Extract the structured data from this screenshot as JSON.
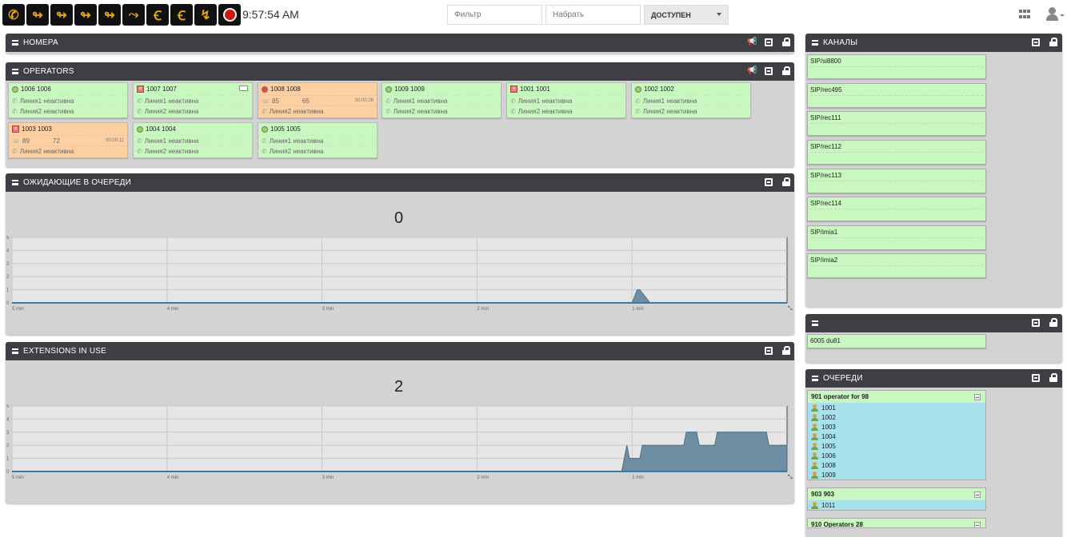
{
  "toolbar": {
    "buttons": [
      "phone-icon",
      "call-forward-icon",
      "call-forward-chat-icon",
      "call-forward-mail-icon",
      "call-forward-mobile-icon",
      "call-transfer-icon",
      "listen-icon",
      "whisper-icon",
      "hangup-icon",
      "record-stop-icon"
    ],
    "clock": "9:57:54 AM",
    "filter_placeholder": "Фильтр",
    "dial_placeholder": "Набрать",
    "status_value": "ДОСТУПЕН"
  },
  "panels": {
    "numbers": {
      "title": "НОМЕРА"
    },
    "operators": {
      "title": "OPERATORS"
    },
    "waiting": {
      "title": "ОЖИДАЮЩИЕ В ОЧЕРЕДИ",
      "count": "0"
    },
    "extensions": {
      "title": "EXTENSIONS IN USE",
      "count": "2"
    },
    "channels": {
      "title": "КАНАЛЫ"
    },
    "parked": {
      "title": ""
    },
    "queues": {
      "title": "ОЧЕРЕДИ"
    }
  },
  "operators": [
    {
      "name": "1006 1006",
      "status": "available",
      "line1": "Линия1 неактивна",
      "line2": "Линия2 неактивна"
    },
    {
      "name": "1007 1007",
      "status": "offline",
      "line1": "Линия1 неактивна",
      "line2": "Линия2 неактивна",
      "mail": true
    },
    {
      "name": "1008 1008",
      "status": "busy",
      "line1_a": "85",
      "line1_b": "65",
      "line1_time": "00:00:26",
      "line2": "Линия2 неактивна"
    },
    {
      "name": "1009 1009",
      "status": "available",
      "line1": "Линия1 неактивна",
      "line2": "Линия2 неактивна"
    },
    {
      "name": "1001 1001",
      "status": "offline",
      "line1": "Линия1 неактивна",
      "line2": "Линия2 неактивна"
    },
    {
      "name": "1002 1002",
      "status": "available",
      "line1": "Линия1 неактивна",
      "line2": "Линия2 неактивна"
    },
    {
      "name": "1003 1003",
      "status": "offline",
      "line1_a": "89",
      "line1_b": "72",
      "line1_time": "00:00:11",
      "line2": "Линия2 неактивна"
    },
    {
      "name": "1004 1004",
      "status": "available",
      "line1": "Линия1 неактивна",
      "line2": "Линия2 неактивна"
    },
    {
      "name": "1005 1005",
      "status": "available",
      "line1": "Линия1 неактивна",
      "line2": "Линия2 неактивна"
    }
  ],
  "channels": [
    "SIP/si8800",
    "SIP/rec495",
    "SIP/rec111",
    "SIP/rec112",
    "SIP/rec113",
    "SIP/rec114",
    "SIP/imia1",
    "SIP/imia2"
  ],
  "parked": [
    "6005 du81"
  ],
  "queues": [
    {
      "name": "901 operator for 98",
      "members": [
        "1001",
        "1002",
        "1003",
        "1004",
        "1005",
        "1006",
        "1008",
        "1009"
      ]
    },
    {
      "name": "903 903",
      "members": [
        "1011"
      ]
    },
    {
      "name": "910 Operators 28",
      "members": []
    }
  ],
  "colors": {
    "header": "#3d3f44",
    "card_green": "#c9f7c0",
    "card_orange": "#fdd0a3",
    "queue_blue": "#a6e1ec",
    "chart_fill": "#6e8ea3"
  },
  "chart_data": [
    {
      "type": "area",
      "title": "",
      "x_ticks": [
        "5 min",
        "4 min",
        "3 min",
        "2 min",
        "1 min"
      ],
      "y_ticks": [
        "0",
        "1",
        "2",
        "3",
        "4",
        "5"
      ],
      "ylim": [
        0,
        5
      ],
      "x": [
        300,
        60,
        58,
        57,
        53,
        52,
        0
      ],
      "y": [
        0,
        0,
        1,
        1,
        0,
        0,
        0
      ]
    },
    {
      "type": "area",
      "title": "",
      "x_ticks": [
        "5 min",
        "4 min",
        "3 min",
        "2 min",
        "1 min"
      ],
      "y_ticks": [
        "0",
        "1",
        "2",
        "3",
        "4",
        "5"
      ],
      "ylim": [
        0,
        5
      ],
      "x": [
        300,
        64,
        62,
        61,
        57,
        56,
        40,
        39,
        35,
        34,
        28,
        27,
        8,
        7,
        0
      ],
      "y": [
        0,
        0,
        2,
        1,
        1,
        2,
        2,
        3,
        3,
        2,
        2,
        3,
        3,
        2,
        2
      ]
    }
  ]
}
